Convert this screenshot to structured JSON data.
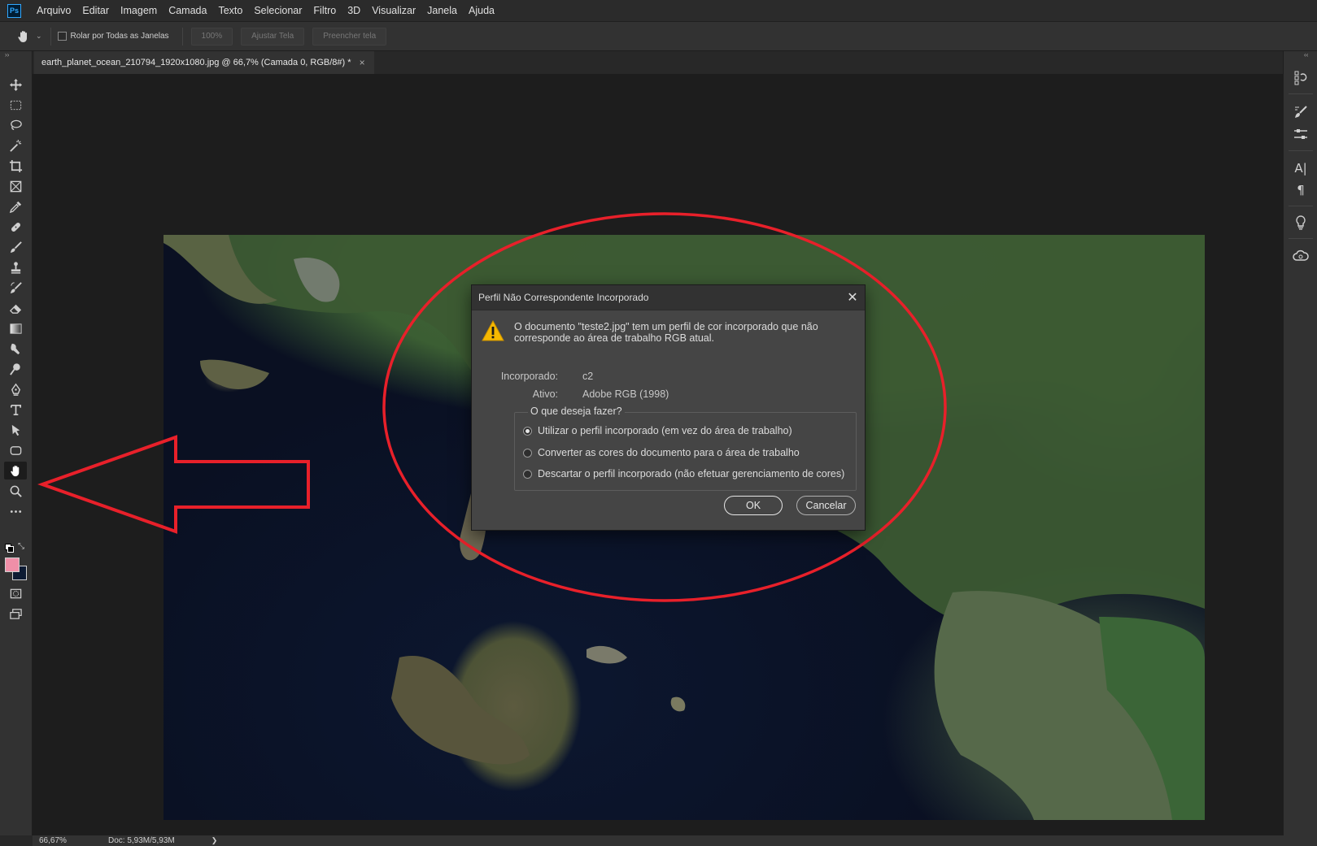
{
  "app": {
    "logo_text": "Ps"
  },
  "menu": [
    "Arquivo",
    "Editar",
    "Imagem",
    "Camada",
    "Texto",
    "Selecionar",
    "Filtro",
    "3D",
    "Visualizar",
    "Janela",
    "Ajuda"
  ],
  "options_bar": {
    "scroll_all_label": "Rolar por Todas as Janelas",
    "zoom_value": "100%",
    "fit_label": "Ajustar Tela",
    "fill_label": "Preencher tela"
  },
  "document_tab": {
    "title": "earth_planet_ocean_210794_1920x1080.jpg @ 66,7% (Camada 0, RGB/8#) *",
    "close": "×"
  },
  "status_bar": {
    "zoom": "66,67%",
    "doc_size": "Doc: 5,93M/5,93M",
    "arrow": "❯"
  },
  "tools": [
    "move-icon",
    "marquee-icon",
    "lasso-icon",
    "magic-wand-icon",
    "crop-icon",
    "frame-icon",
    "eyedropper-icon",
    "healing-icon",
    "brush-icon",
    "stamp-icon",
    "history-brush-icon",
    "eraser-icon",
    "gradient-icon",
    "smudge-icon",
    "dodge-icon",
    "pen-icon",
    "type-icon",
    "path-select-icon",
    "shape-icon",
    "hand-icon",
    "zoom-icon",
    "more-icon"
  ],
  "colors": {
    "foreground": "#f08fa8",
    "background": "#0d1b33",
    "annotation_red": "#e8202a"
  },
  "dialog": {
    "title": "Perfil Não Correspondente Incorporado",
    "message": "O documento \"teste2.jpg\" tem um perfil de cor incorporado que não corresponde ao área de trabalho RGB atual.",
    "embedded_label": "Incorporado:",
    "embedded_value": "c2",
    "active_label": "Ativo:",
    "active_value": "Adobe RGB (1998)",
    "group_label": "O que deseja fazer?",
    "options": [
      {
        "label": "Utilizar o perfil incorporado (em vez do área de trabalho)",
        "selected": true
      },
      {
        "label": "Converter as cores do documento para o área de trabalho",
        "selected": false
      },
      {
        "label": "Descartar o perfil incorporado (não efetuar gerenciamento de cores)",
        "selected": false
      }
    ],
    "ok_label": "OK",
    "cancel_label": "Cancelar"
  }
}
